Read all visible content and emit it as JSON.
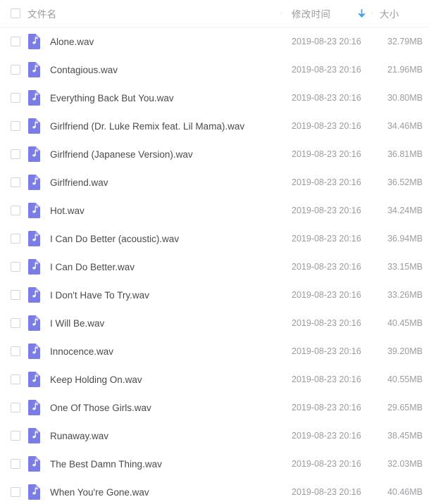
{
  "header": {
    "select_all_checkbox": "unchecked",
    "columns": {
      "name": "文件名",
      "time": "修改时间",
      "size": "大小"
    },
    "sort": {
      "column": "修改时间",
      "direction": "descending",
      "icon": "arrow-down-icon",
      "color": "#33a3f4"
    }
  },
  "icons": {
    "file_audio": "music-file-icon",
    "file_color": "#7b7de6",
    "file_corner_color": "#a8a9ef"
  },
  "files": [
    {
      "name": "Alone.wav",
      "time": "2019-08-23 20:16",
      "size": "32.79MB",
      "checked": false
    },
    {
      "name": "Contagious.wav",
      "time": "2019-08-23 20:16",
      "size": "21.96MB",
      "checked": false
    },
    {
      "name": "Everything Back But You.wav",
      "time": "2019-08-23 20:16",
      "size": "30.80MB",
      "checked": false
    },
    {
      "name": "Girlfriend (Dr. Luke Remix feat. Lil Mama).wav",
      "time": "2019-08-23 20:16",
      "size": "34.46MB",
      "checked": false
    },
    {
      "name": "Girlfriend (Japanese Version).wav",
      "time": "2019-08-23 20:16",
      "size": "36.81MB",
      "checked": false
    },
    {
      "name": "Girlfriend.wav",
      "time": "2019-08-23 20:16",
      "size": "36.52MB",
      "checked": false
    },
    {
      "name": "Hot.wav",
      "time": "2019-08-23 20:16",
      "size": "34.24MB",
      "checked": false
    },
    {
      "name": "I Can Do Better (acoustic).wav",
      "time": "2019-08-23 20:16",
      "size": "36.94MB",
      "checked": false
    },
    {
      "name": "I Can Do Better.wav",
      "time": "2019-08-23 20:16",
      "size": "33.15MB",
      "checked": false
    },
    {
      "name": "I Don't Have To Try.wav",
      "time": "2019-08-23 20:16",
      "size": "33.26MB",
      "checked": false
    },
    {
      "name": "I Will Be.wav",
      "time": "2019-08-23 20:16",
      "size": "40.45MB",
      "checked": false
    },
    {
      "name": "Innocence.wav",
      "time": "2019-08-23 20:16",
      "size": "39.20MB",
      "checked": false
    },
    {
      "name": "Keep Holding On.wav",
      "time": "2019-08-23 20:16",
      "size": "40.55MB",
      "checked": false
    },
    {
      "name": "One Of Those Girls.wav",
      "time": "2019-08-23 20:16",
      "size": "29.65MB",
      "checked": false
    },
    {
      "name": "Runaway.wav",
      "time": "2019-08-23 20:16",
      "size": "38.45MB",
      "checked": false
    },
    {
      "name": "The Best Damn Thing.wav",
      "time": "2019-08-23 20:16",
      "size": "32.03MB",
      "checked": false
    },
    {
      "name": "When You're Gone.wav",
      "time": "2019-08-23 20:16",
      "size": "40.46MB",
      "checked": false
    }
  ]
}
